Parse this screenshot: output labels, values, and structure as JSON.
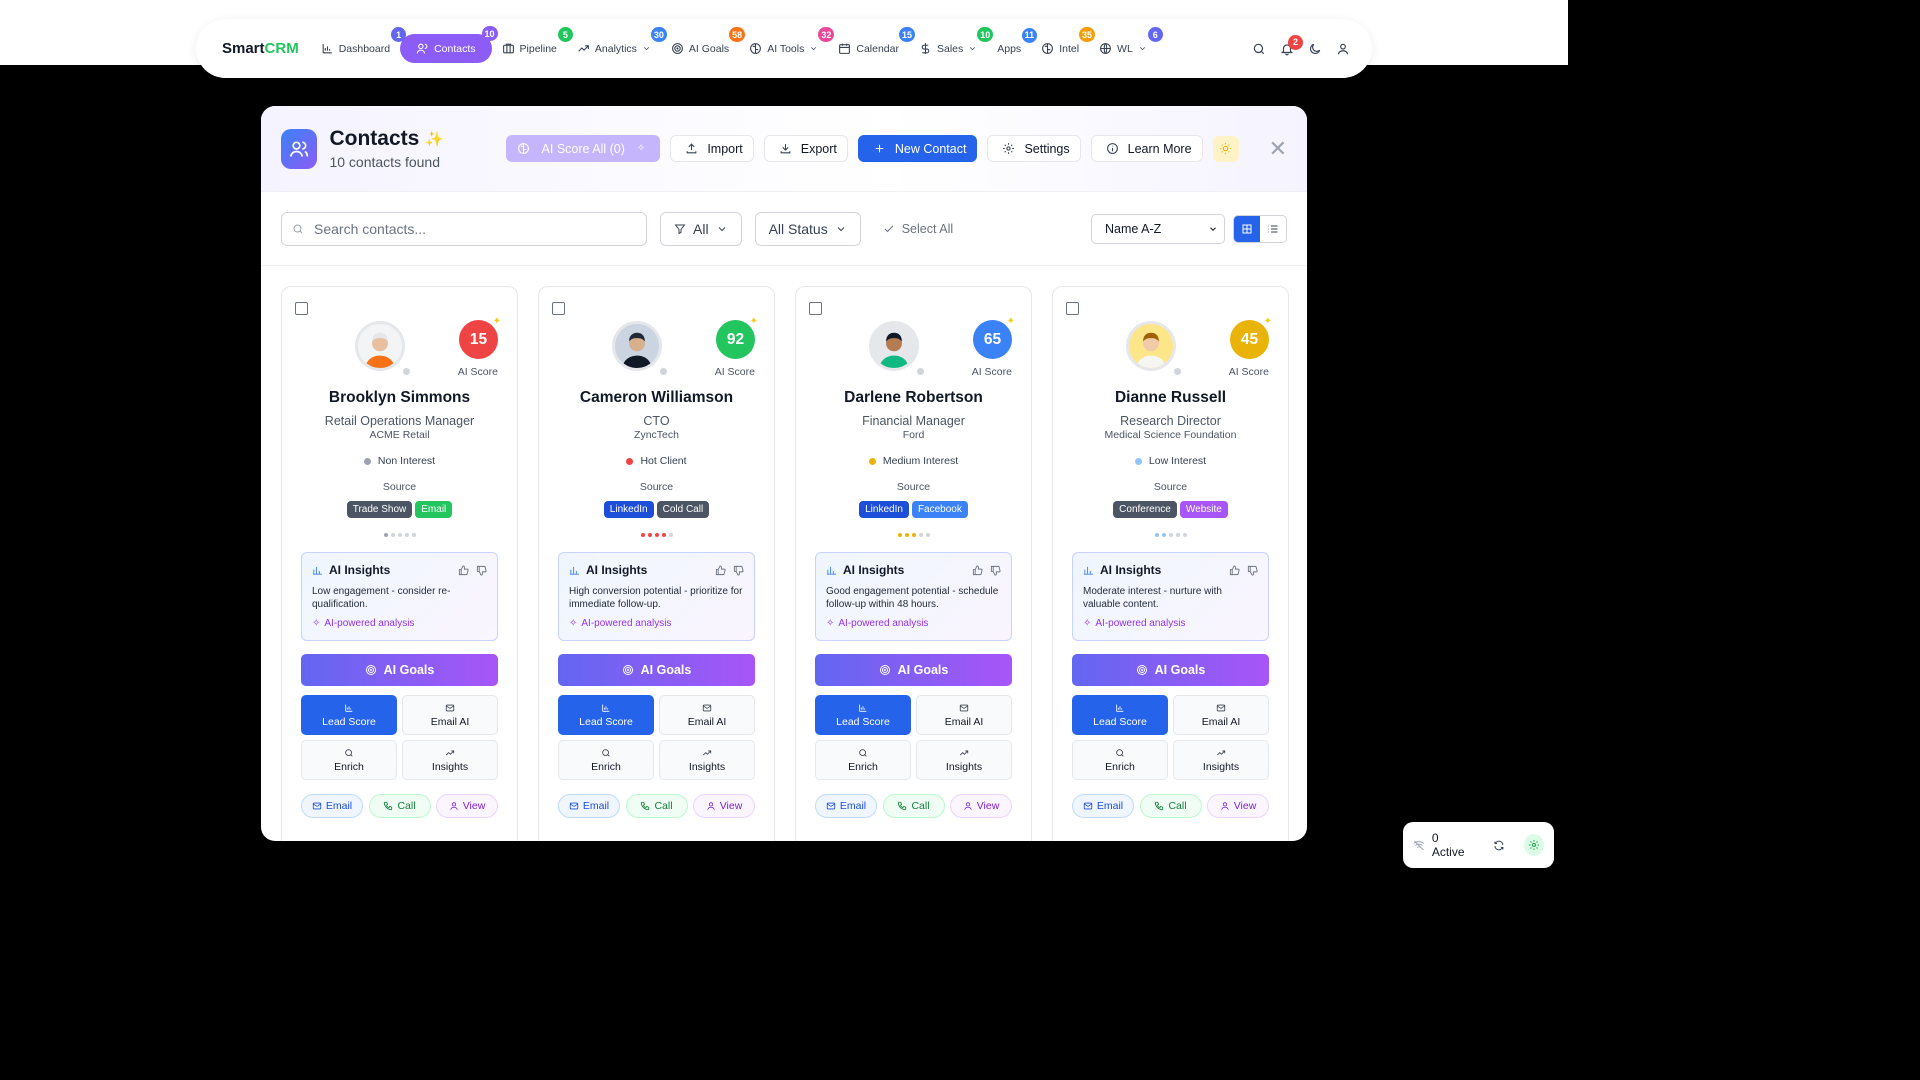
{
  "navbar": {
    "brand_a": "Smart",
    "brand_b": "CRM",
    "items": [
      {
        "label": "Dashboard",
        "badge": "1",
        "badge_color": "#6366f1"
      },
      {
        "label": "Contacts",
        "badge": "10",
        "badge_color": "#8b5cf6"
      },
      {
        "label": "Pipeline",
        "badge": "5",
        "badge_color": "#22c55e"
      },
      {
        "label": "Analytics",
        "badge": "30",
        "badge_color": "#3b82f6"
      },
      {
        "label": "AI Goals",
        "badge": "58",
        "badge_color": "#f97316"
      },
      {
        "label": "AI Tools",
        "badge": "32",
        "badge_color": "#ec4899"
      },
      {
        "label": "Calendar",
        "badge": "15",
        "badge_color": "#3b82f6"
      },
      {
        "label": "Sales",
        "badge": "10",
        "badge_color": "#22c55e"
      },
      {
        "label": "Apps",
        "badge": "11",
        "badge_color": "#3b82f6"
      },
      {
        "label": "Intel",
        "badge": "35",
        "badge_color": "#f59e0b"
      },
      {
        "label": "WL",
        "badge": "6",
        "badge_color": "#6366f1"
      }
    ],
    "notifications_badge": "2"
  },
  "header": {
    "title": "Contacts",
    "subtitle": "10 contacts found",
    "ai_score_all": "AI Score All (0)",
    "import": "Import",
    "export": "Export",
    "new_contact": "New Contact",
    "settings": "Settings",
    "learn_more": "Learn More"
  },
  "filters": {
    "search_placeholder": "Search contacts...",
    "filter_all": "All",
    "status": "All Status",
    "select_all": "Select All",
    "sort": "Name A-Z"
  },
  "contacts": [
    {
      "name": "Brooklyn Simmons",
      "role": "Retail Operations Manager",
      "company": "ACME Retail",
      "score": "15",
      "score_color": "#ef4444",
      "score_label": "AI Score",
      "interest": "Non Interest",
      "interest_color": "#9ca3af",
      "source_label": "Source",
      "tags": [
        {
          "label": "Trade Show",
          "color": "#4b5563"
        },
        {
          "label": "Email",
          "color": "#22c55e"
        }
      ],
      "insight_title": "AI Insights",
      "insight": "Low engagement - consider re-qualification.",
      "powered": "AI-powered analysis"
    },
    {
      "name": "Cameron Williamson",
      "role": "CTO",
      "company": "ZyncTech",
      "score": "92",
      "score_color": "#22c55e",
      "score_label": "AI Score",
      "interest": "Hot Client",
      "interest_color": "#ef4444",
      "source_label": "Source",
      "tags": [
        {
          "label": "LinkedIn",
          "color": "#1d4ed8"
        },
        {
          "label": "Cold Call",
          "color": "#4b5563"
        }
      ],
      "insight_title": "AI Insights",
      "insight": "High conversion potential - prioritize for immediate follow-up.",
      "powered": "AI-powered analysis"
    },
    {
      "name": "Darlene Robertson",
      "role": "Financial Manager",
      "company": "Ford",
      "score": "65",
      "score_color": "#3b82f6",
      "score_label": "AI Score",
      "interest": "Medium Interest",
      "interest_color": "#eab308",
      "source_label": "Source",
      "tags": [
        {
          "label": "LinkedIn",
          "color": "#1d4ed8"
        },
        {
          "label": "Facebook",
          "color": "#3b82f6"
        }
      ],
      "insight_title": "AI Insights",
      "insight": "Good engagement potential - schedule follow-up within 48 hours.",
      "powered": "AI-powered analysis"
    },
    {
      "name": "Dianne Russell",
      "role": "Research Director",
      "company": "Medical Science Foundation",
      "score": "45",
      "score_color": "#eab308",
      "score_label": "AI Score",
      "interest": "Low Interest",
      "interest_color": "#93c5fd",
      "source_label": "Source",
      "tags": [
        {
          "label": "Conference",
          "color": "#4b5563"
        },
        {
          "label": "Website",
          "color": "#a855f7"
        }
      ],
      "insight_title": "AI Insights",
      "insight": "Moderate interest - nurture with valuable content.",
      "powered": "AI-powered analysis"
    }
  ],
  "card_actions": {
    "ai_goals": "AI Goals",
    "lead_score": "Lead Score",
    "email_ai": "Email AI",
    "enrich": "Enrich",
    "insights": "Insights",
    "email": "Email",
    "call": "Call",
    "view": "View"
  },
  "status_widget": {
    "active": "0 Active"
  }
}
